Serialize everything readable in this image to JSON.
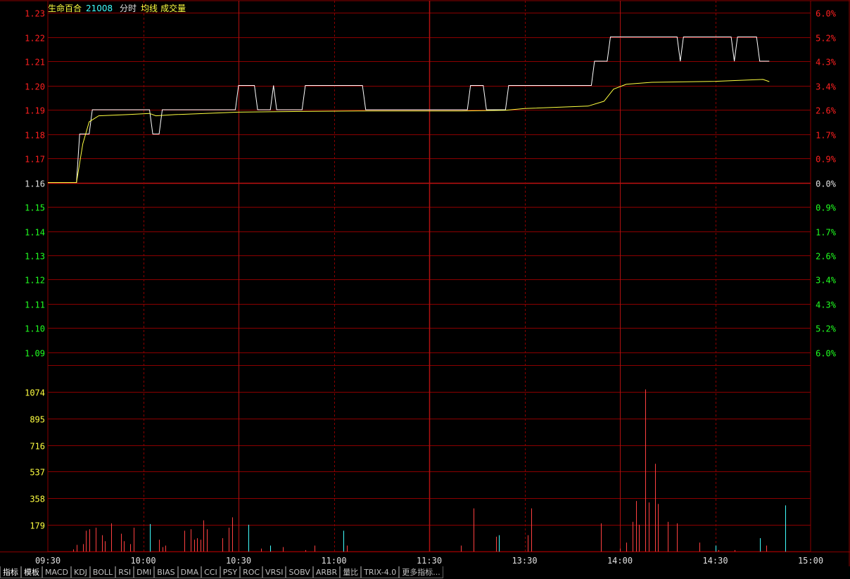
{
  "header": {
    "stock_name": "生命百合",
    "stock_code": "21008",
    "view_label": "分时",
    "avg_label": "均线",
    "vol_label": "成交量"
  },
  "colors": {
    "grid": "#8b0000",
    "axis_up": "#ff2020",
    "axis_down": "#20ff20",
    "axis_flat": "#e0e0e0",
    "price_line": "#ffffff",
    "avg_line": "#ffff40",
    "vol_up": "#ff4040",
    "vol_down": "#40ffff",
    "vol_axis": "#ffff40"
  },
  "chart_data": {
    "type": "line",
    "prev_close": 1.16,
    "price_axis": [
      "1.23",
      "1.22",
      "1.21",
      "1.20",
      "1.19",
      "1.18",
      "1.17",
      "1.16",
      "1.15",
      "1.14",
      "1.13",
      "1.12",
      "1.11",
      "1.10",
      "1.09"
    ],
    "pct_axis": [
      "6.0%",
      "5.2%",
      "4.3%",
      "3.4%",
      "2.6%",
      "1.7%",
      "0.9%",
      "0.0%",
      "0.9%",
      "1.7%",
      "2.6%",
      "3.4%",
      "4.3%",
      "5.2%",
      "6.0%"
    ],
    "price_ylim": [
      1.09,
      1.23
    ],
    "time_labels": [
      "09:30",
      "10:00",
      "10:30",
      "11:00",
      "11:30",
      "13:30",
      "14:00",
      "14:30",
      "15:00"
    ],
    "price_series": [
      [
        0,
        1.16
      ],
      [
        9,
        1.16
      ],
      [
        10,
        1.18
      ],
      [
        13,
        1.18
      ],
      [
        14,
        1.19
      ],
      [
        32,
        1.19
      ],
      [
        33,
        1.18
      ],
      [
        35,
        1.18
      ],
      [
        36,
        1.19
      ],
      [
        59,
        1.19
      ],
      [
        60,
        1.2
      ],
      [
        65,
        1.2
      ],
      [
        66,
        1.19
      ],
      [
        70,
        1.19
      ],
      [
        71,
        1.2
      ],
      [
        72,
        1.19
      ],
      [
        80,
        1.19
      ],
      [
        81,
        1.2
      ],
      [
        99,
        1.2
      ],
      [
        100,
        1.19
      ],
      [
        132,
        1.19
      ],
      [
        133,
        1.2
      ],
      [
        137,
        1.2
      ],
      [
        138,
        1.19
      ],
      [
        144,
        1.19
      ],
      [
        145,
        1.2
      ],
      [
        171,
        1.2
      ],
      [
        172,
        1.21
      ],
      [
        176,
        1.21
      ],
      [
        177,
        1.22
      ],
      [
        198,
        1.22
      ],
      [
        199,
        1.21
      ],
      [
        200,
        1.22
      ],
      [
        215,
        1.22
      ],
      [
        216,
        1.21
      ],
      [
        217,
        1.22
      ],
      [
        223,
        1.22
      ],
      [
        224,
        1.21
      ],
      [
        227,
        1.21
      ]
    ],
    "avg_series": [
      [
        0,
        1.16
      ],
      [
        9,
        1.16
      ],
      [
        11,
        1.176
      ],
      [
        13,
        1.185
      ],
      [
        16,
        1.1875
      ],
      [
        25,
        1.188
      ],
      [
        32,
        1.1885
      ],
      [
        34,
        1.1875
      ],
      [
        40,
        1.188
      ],
      [
        60,
        1.189
      ],
      [
        80,
        1.1893
      ],
      [
        100,
        1.1895
      ],
      [
        130,
        1.1895
      ],
      [
        144,
        1.1898
      ],
      [
        150,
        1.1905
      ],
      [
        170,
        1.1915
      ],
      [
        175,
        1.1935
      ],
      [
        178,
        1.1985
      ],
      [
        182,
        1.2005
      ],
      [
        190,
        1.2013
      ],
      [
        210,
        1.2017
      ],
      [
        225,
        1.2025
      ],
      [
        227,
        1.2016
      ]
    ],
    "volume_axis": [
      "1074",
      "895",
      "716",
      "537",
      "358",
      "179"
    ],
    "volume_ylim": [
      0,
      1253
    ],
    "volume": [
      [
        8,
        15,
        "up"
      ],
      [
        9,
        45,
        "up"
      ],
      [
        11,
        50,
        "up"
      ],
      [
        12,
        140,
        "up"
      ],
      [
        13,
        150,
        "up"
      ],
      [
        15,
        160,
        "up"
      ],
      [
        17,
        110,
        "up"
      ],
      [
        18,
        70,
        "up"
      ],
      [
        20,
        190,
        "up"
      ],
      [
        23,
        120,
        "up"
      ],
      [
        24,
        70,
        "up"
      ],
      [
        26,
        50,
        "up"
      ],
      [
        27,
        160,
        "up"
      ],
      [
        32,
        185,
        "down"
      ],
      [
        35,
        80,
        "up"
      ],
      [
        36,
        30,
        "up"
      ],
      [
        37,
        40,
        "up"
      ],
      [
        43,
        140,
        "up"
      ],
      [
        45,
        150,
        "up"
      ],
      [
        46,
        80,
        "up"
      ],
      [
        47,
        90,
        "up"
      ],
      [
        48,
        80,
        "up"
      ],
      [
        49,
        210,
        "up"
      ],
      [
        50,
        150,
        "up"
      ],
      [
        55,
        90,
        "up"
      ],
      [
        57,
        160,
        "up"
      ],
      [
        58,
        230,
        "up"
      ],
      [
        63,
        180,
        "down"
      ],
      [
        67,
        20,
        "up"
      ],
      [
        70,
        40,
        "down"
      ],
      [
        74,
        30,
        "up"
      ],
      [
        81,
        10,
        "up"
      ],
      [
        84,
        40,
        "up"
      ],
      [
        93,
        140,
        "down"
      ],
      [
        94,
        40,
        "up"
      ],
      [
        130,
        40,
        "up"
      ],
      [
        134,
        290,
        "up"
      ],
      [
        141,
        100,
        "up"
      ],
      [
        142,
        110,
        "down"
      ],
      [
        151,
        110,
        "up"
      ],
      [
        152,
        290,
        "up"
      ],
      [
        174,
        190,
        "up"
      ],
      [
        180,
        20,
        "up"
      ],
      [
        182,
        60,
        "up"
      ],
      [
        184,
        200,
        "up"
      ],
      [
        185,
        340,
        "up"
      ],
      [
        186,
        180,
        "up"
      ],
      [
        188,
        1090,
        "up"
      ],
      [
        189,
        330,
        "up"
      ],
      [
        191,
        590,
        "up"
      ],
      [
        192,
        320,
        "up"
      ],
      [
        195,
        200,
        "up"
      ],
      [
        198,
        190,
        "up"
      ],
      [
        205,
        60,
        "up"
      ],
      [
        210,
        40,
        "down"
      ],
      [
        211,
        10,
        "up"
      ],
      [
        216,
        10,
        "up"
      ],
      [
        224,
        90,
        "down"
      ],
      [
        226,
        40,
        "up"
      ],
      [
        232,
        310,
        "down"
      ]
    ]
  },
  "toolbar": {
    "tabs": [
      "指标",
      "模板",
      "MACD",
      "KDJ",
      "BOLL",
      "RSI",
      "DMI",
      "BIAS",
      "DMA",
      "CCI",
      "PSY",
      "ROC",
      "VRSI",
      "SOBV",
      "ARBR",
      "量比",
      "TRIX-4.0",
      "更多指标..."
    ]
  }
}
